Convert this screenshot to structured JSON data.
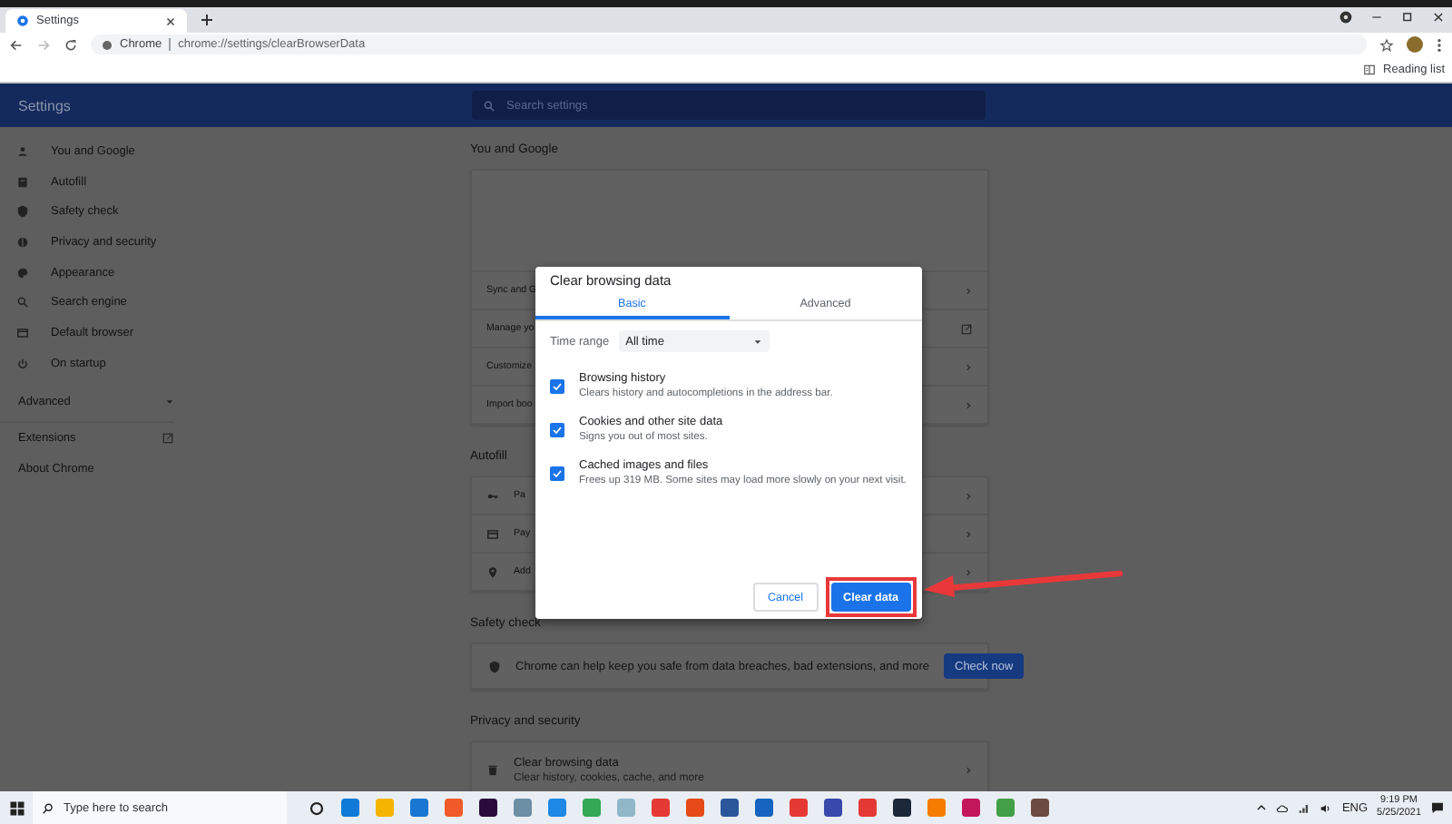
{
  "browser": {
    "tabs": [
      {
        "title": "Settings",
        "selected": true
      }
    ],
    "omnibox": {
      "origin": "Chrome",
      "url": "chrome://settings/clearBrowserData"
    },
    "bookmarks_bar": {
      "reading_list": "Reading list"
    }
  },
  "settings_header": {
    "title": "Settings",
    "search": {
      "placeholder": "Search settings"
    }
  },
  "sidebar": {
    "items": [
      {
        "label": "You and Google"
      },
      {
        "label": "Autofill"
      },
      {
        "label": "Safety check"
      },
      {
        "label": "Privacy and security"
      },
      {
        "label": "Appearance"
      },
      {
        "label": "Search engine"
      },
      {
        "label": "Default browser"
      },
      {
        "label": "On startup"
      }
    ],
    "advanced": {
      "label": "Advanced",
      "expanded": false
    },
    "links": [
      {
        "label": "Extensions",
        "kind": "external"
      },
      {
        "label": "About Chrome",
        "kind": "plain"
      }
    ]
  },
  "sections": [
    {
      "kind": "rows",
      "title": "You and Google",
      "profile_area": true,
      "rows": [
        {
          "label": "Sync and G",
          "kind": "chevron"
        },
        {
          "label": "Manage yo",
          "kind": "external"
        },
        {
          "label": "Customize",
          "kind": "chevron"
        },
        {
          "label": "Import boo",
          "kind": "chevron"
        }
      ]
    },
    {
      "kind": "rows",
      "title": "Autofill",
      "profile_area": false,
      "rows": [
        {
          "label": "Pa",
          "kind": "chevron"
        },
        {
          "label": "Pay",
          "kind": "chevron"
        },
        {
          "label": "Add",
          "kind": "chevron"
        }
      ]
    },
    {
      "kind": "message",
      "title": "Safety check",
      "message": "Chrome can help keep you safe from data breaches, bad extensions, and more",
      "button": "Check now"
    },
    {
      "kind": "rows",
      "title": "Privacy and security",
      "profile_area": false,
      "rows": [
        {
          "label": "Clear browsing data",
          "description": "Clear history, cookies, cache, and more",
          "kind": "chevron"
        }
      ]
    }
  ],
  "dialog": {
    "title": "Clear browsing data",
    "tabs": [
      {
        "label": "Basic",
        "selected": true
      },
      {
        "label": "Advanced",
        "selected": false
      }
    ],
    "time_range": {
      "label": "Time range",
      "value": "All time"
    },
    "options": [
      {
        "title": "Browsing history",
        "description": "Clears history and autocompletions in the address bar.",
        "checked": true
      },
      {
        "title": "Cookies and other site data",
        "description": "Signs you out of most sites.",
        "checked": true
      },
      {
        "title": "Cached images and files",
        "description": "Frees up 319 MB. Some sites may load more slowly on your next visit.",
        "checked": true
      }
    ],
    "buttons": [
      {
        "label": "Cancel",
        "kind": "secondary",
        "highlighted": false
      },
      {
        "label": "Clear data",
        "kind": "primary",
        "highlighted": true
      }
    ]
  },
  "taskbar": {
    "search": {
      "placeholder": "Type here to search"
    },
    "language": "ENG",
    "time": "9:19 PM",
    "date": "5/25/2021"
  }
}
